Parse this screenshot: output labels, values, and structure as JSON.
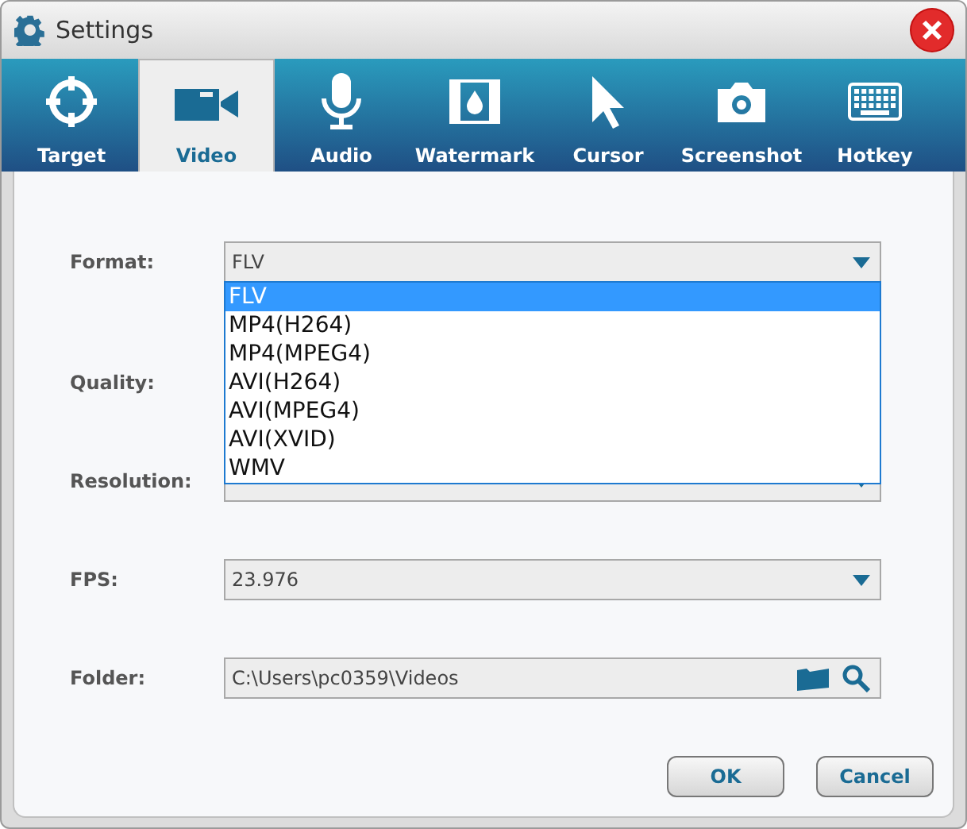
{
  "window": {
    "title": "Settings"
  },
  "tabs": [
    {
      "label": "Target",
      "kind": "target",
      "selected": false
    },
    {
      "label": "Video",
      "kind": "video",
      "selected": true
    },
    {
      "label": "Audio",
      "kind": "mic",
      "selected": false
    },
    {
      "label": "Watermark",
      "kind": "film",
      "selected": false
    },
    {
      "label": "Cursor",
      "kind": "cursor",
      "selected": false
    },
    {
      "label": "Screenshot",
      "kind": "camera",
      "selected": false
    },
    {
      "label": "Hotkey",
      "kind": "keyboard",
      "selected": false
    }
  ],
  "fields": [
    {
      "label": "Format:",
      "kind": "dropdown",
      "value": "FLV"
    },
    {
      "label": "Quality:"
    },
    {
      "label": "Resolution:",
      "kind": "dropdown"
    },
    {
      "label": "FPS:",
      "kind": "dropdown",
      "value": "23.976"
    },
    {
      "label": "Folder:",
      "kind": "path",
      "value": "C:\\Users\\pc0359\\Videos"
    }
  ],
  "dropdown_list": [
    {
      "label": "FLV",
      "selected": true
    },
    {
      "label": "MP4(H264)",
      "selected": false
    },
    {
      "label": "MP4(MPEG4)",
      "selected": false
    },
    {
      "label": "AVI(H264)",
      "selected": false
    },
    {
      "label": "AVI(MPEG4)",
      "selected": false
    },
    {
      "label": "AVI(XVID)",
      "selected": false
    },
    {
      "label": "WMV",
      "selected": false
    }
  ],
  "buttons": [
    "OK",
    "Cancel"
  ]
}
